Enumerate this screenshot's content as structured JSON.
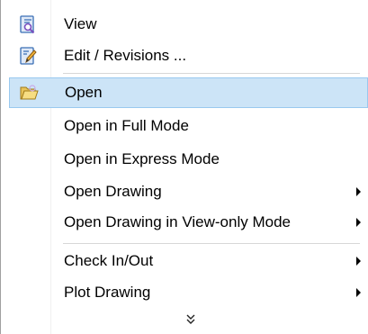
{
  "menu": {
    "items": [
      {
        "label": "View",
        "icon": "view-icon"
      },
      {
        "label": "Edit / Revisions ...",
        "icon": "edit-icon"
      },
      {
        "label": "Open",
        "icon": "folder-open-icon"
      },
      {
        "label": "Open in Full Mode"
      },
      {
        "label": "Open in Express Mode"
      },
      {
        "label": "Open Drawing",
        "submenu": true
      },
      {
        "label": "Open Drawing in View-only Mode",
        "submenu": true
      },
      {
        "label": "Check In/Out",
        "submenu": true
      },
      {
        "label": "Plot Drawing",
        "submenu": true
      }
    ],
    "expand_icon": "double-chevron-down-icon",
    "colors": {
      "highlight_bg": "#cce4f7",
      "highlight_border": "#99c9ef",
      "separator": "#d7d7d7"
    }
  }
}
